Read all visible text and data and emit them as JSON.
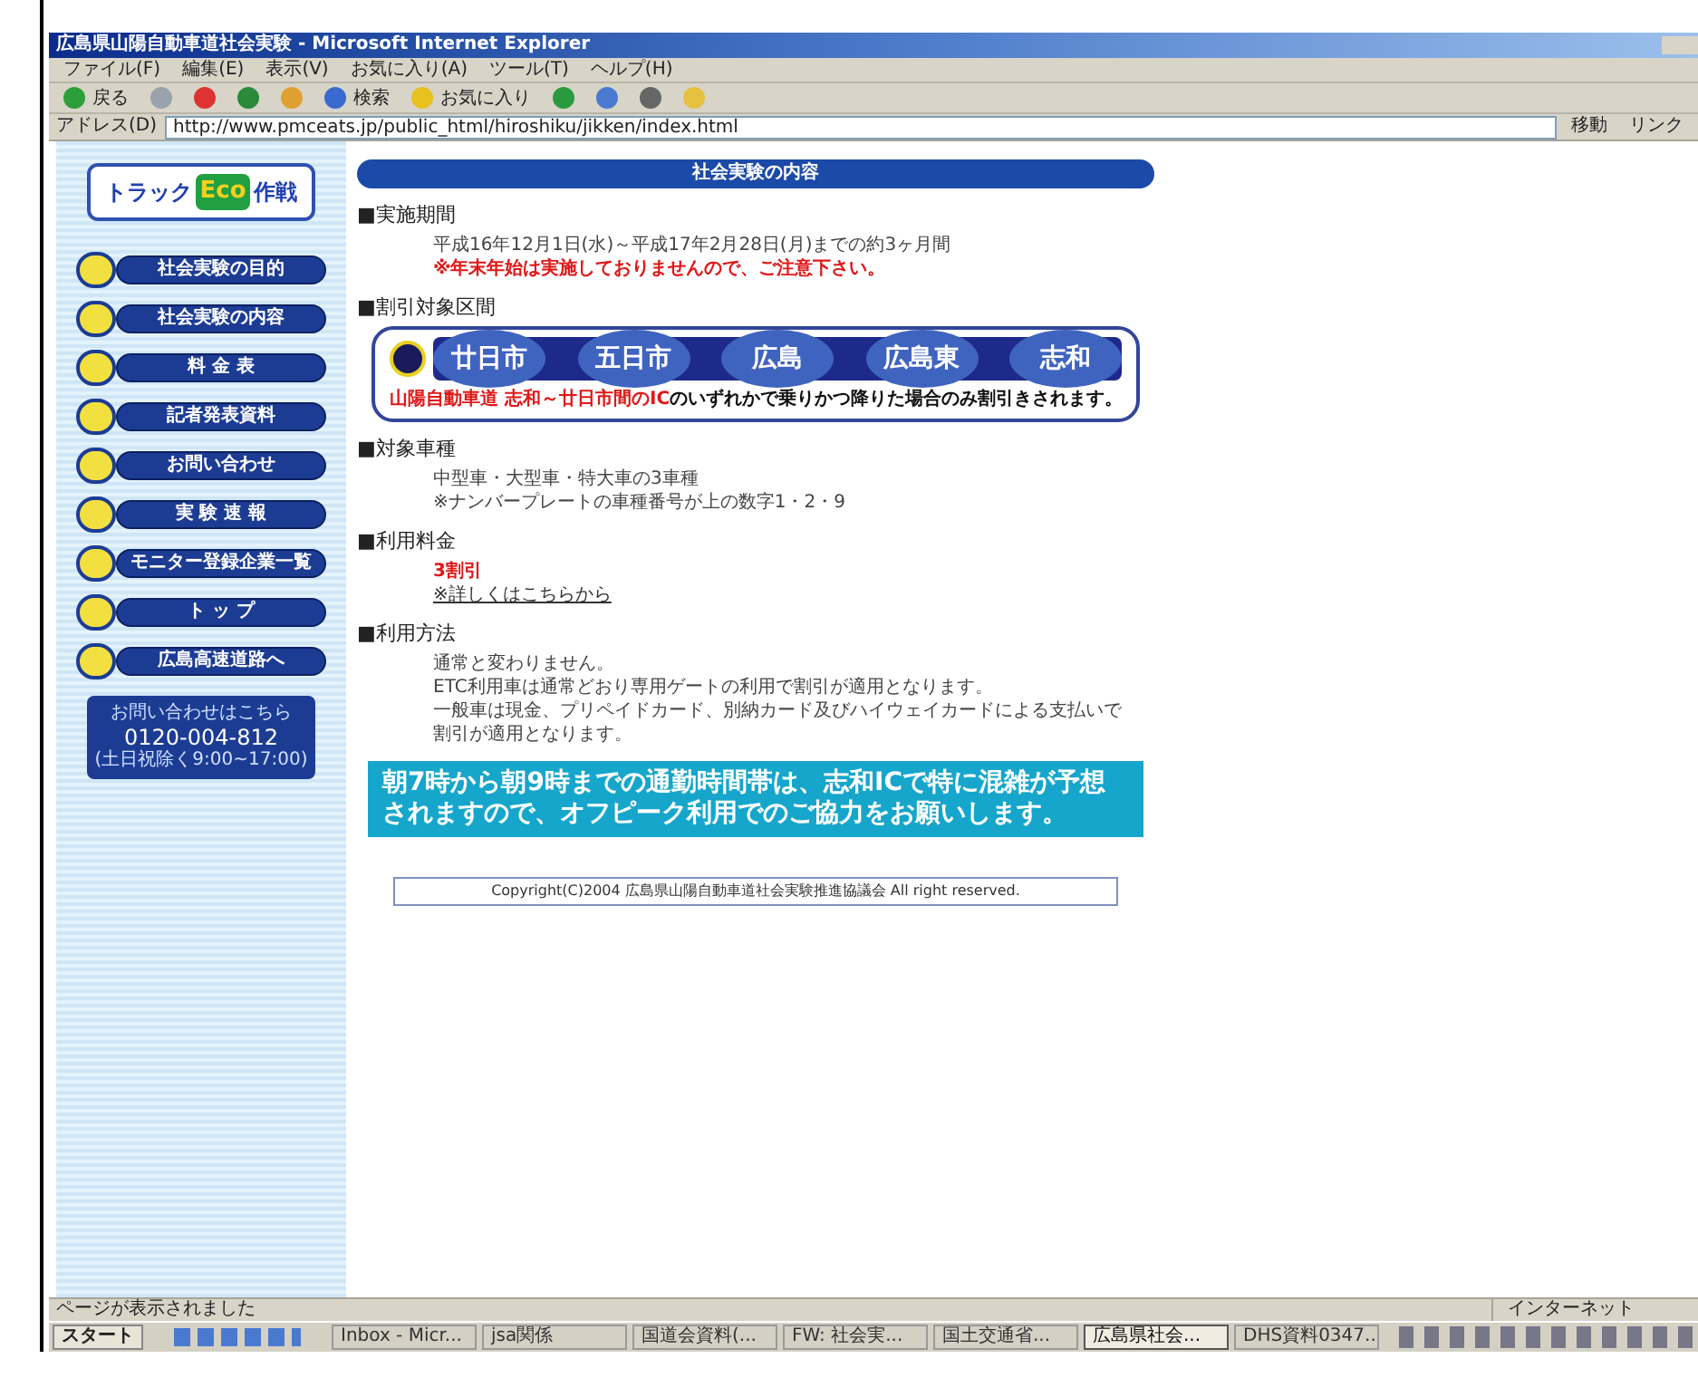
{
  "window": {
    "title": "広島県山陽自動車道社会実験 - Microsoft Internet Explorer"
  },
  "menu": [
    "ファイル(F)",
    "編集(E)",
    "表示(V)",
    "お気に入り(A)",
    "ツール(T)",
    "ヘルプ(H)"
  ],
  "toolbar": [
    {
      "label": "戻る",
      "kind": "back"
    },
    {
      "kind": "forward"
    },
    {
      "kind": "stop"
    },
    {
      "kind": "refresh"
    },
    {
      "kind": "home"
    },
    {
      "label": "検索",
      "kind": "search"
    },
    {
      "label": "お気に入り",
      "kind": "favorites"
    },
    {
      "kind": "media"
    },
    {
      "kind": "mail"
    },
    {
      "kind": "print"
    },
    {
      "kind": "folder"
    }
  ],
  "address": {
    "label": "アドレス(D)",
    "value": "http://www.pmceats.jp/public_html/hiroshiku/jikken/index.html",
    "go": "移動",
    "links": "リンク"
  },
  "sidebar": {
    "logo": [
      "トラック",
      "Eco",
      "作戦"
    ],
    "nav": [
      "社会実験の目的",
      "社会実験の内容",
      "料 金 表",
      "記者発表資料",
      "お問い合わせ",
      "実 験 速 報",
      "モニター登録企業一覧",
      "ト ッ プ",
      "広島高速道路へ"
    ],
    "contact": [
      "お問い合わせはこちら",
      "0120-004-812",
      "(土日祝除く9:00~17:00)"
    ]
  },
  "main": {
    "header": "社会実験の内容",
    "sections": [
      {
        "heading": "■実施期間",
        "kind": "text",
        "lines": [
          {
            "text": "平成16年12月1日(水)～平成17年2月28日(月)までの約3ヶ月間",
            "kind": "plain"
          },
          {
            "text": "※年末年始は実施しておりませんので、ご注意下さい。",
            "kind": "warning"
          }
        ]
      },
      {
        "heading": "■割引対象区間",
        "kind": "route",
        "stations": [
          "廿日市",
          "五日市",
          "広島",
          "広島東",
          "志和"
        ],
        "note_red": "山陽自動車道 志和～廿日市間のIC",
        "note": "のいずれかで乗りかつ降りた場合のみ割引きされます。"
      },
      {
        "heading": "■対象車種",
        "kind": "text",
        "lines": [
          {
            "text": "中型車・大型車・特大車の3車種",
            "kind": "plain"
          },
          {
            "text": "※ナンバープレートの車種番号が上の数字1・2・9",
            "kind": "plain"
          }
        ]
      },
      {
        "heading": "■利用料金",
        "kind": "text",
        "lines": [
          {
            "text": "3割引",
            "kind": "warning"
          },
          {
            "text": "※詳しくはこちらから",
            "kind": "link"
          }
        ]
      },
      {
        "heading": "■利用方法",
        "kind": "text",
        "lines": [
          {
            "text": "通常と変わりません。",
            "kind": "plain"
          },
          {
            "text": "ETC利用車は通常どおり専用ゲートの利用で割引が適用となります。",
            "kind": "plain"
          },
          {
            "text": "一般車は現金、プリペイドカード、別納カード及びハイウェイカードによる支払いで",
            "kind": "plain"
          },
          {
            "text": "割引が適用となります。",
            "kind": "plain"
          }
        ]
      }
    ],
    "banner": "朝7時から朝9時までの通勤時間帯は、志和ICで特に混雑が予想されますので、オフピーク利用でのご協力をお願いします。",
    "footer": "Copyright(C)2004 広島県山陽自動車道社会実験推進協議会 All right reserved."
  },
  "status": {
    "text": "ページが表示されました",
    "zone": "インターネット"
  },
  "taskbar": {
    "start": "スタート",
    "tasks": [
      {
        "label": "Inbox - Micr...",
        "selected": false
      },
      {
        "label": "jsa関係",
        "selected": false
      },
      {
        "label": "国道会資料(...",
        "selected": false
      },
      {
        "label": "FW: 社会実...",
        "selected": false
      },
      {
        "label": "国土交通省...",
        "selected": false
      },
      {
        "label": "広島県社会...",
        "selected": true
      },
      {
        "label": "DHS資料0347...",
        "selected": false
      }
    ]
  }
}
